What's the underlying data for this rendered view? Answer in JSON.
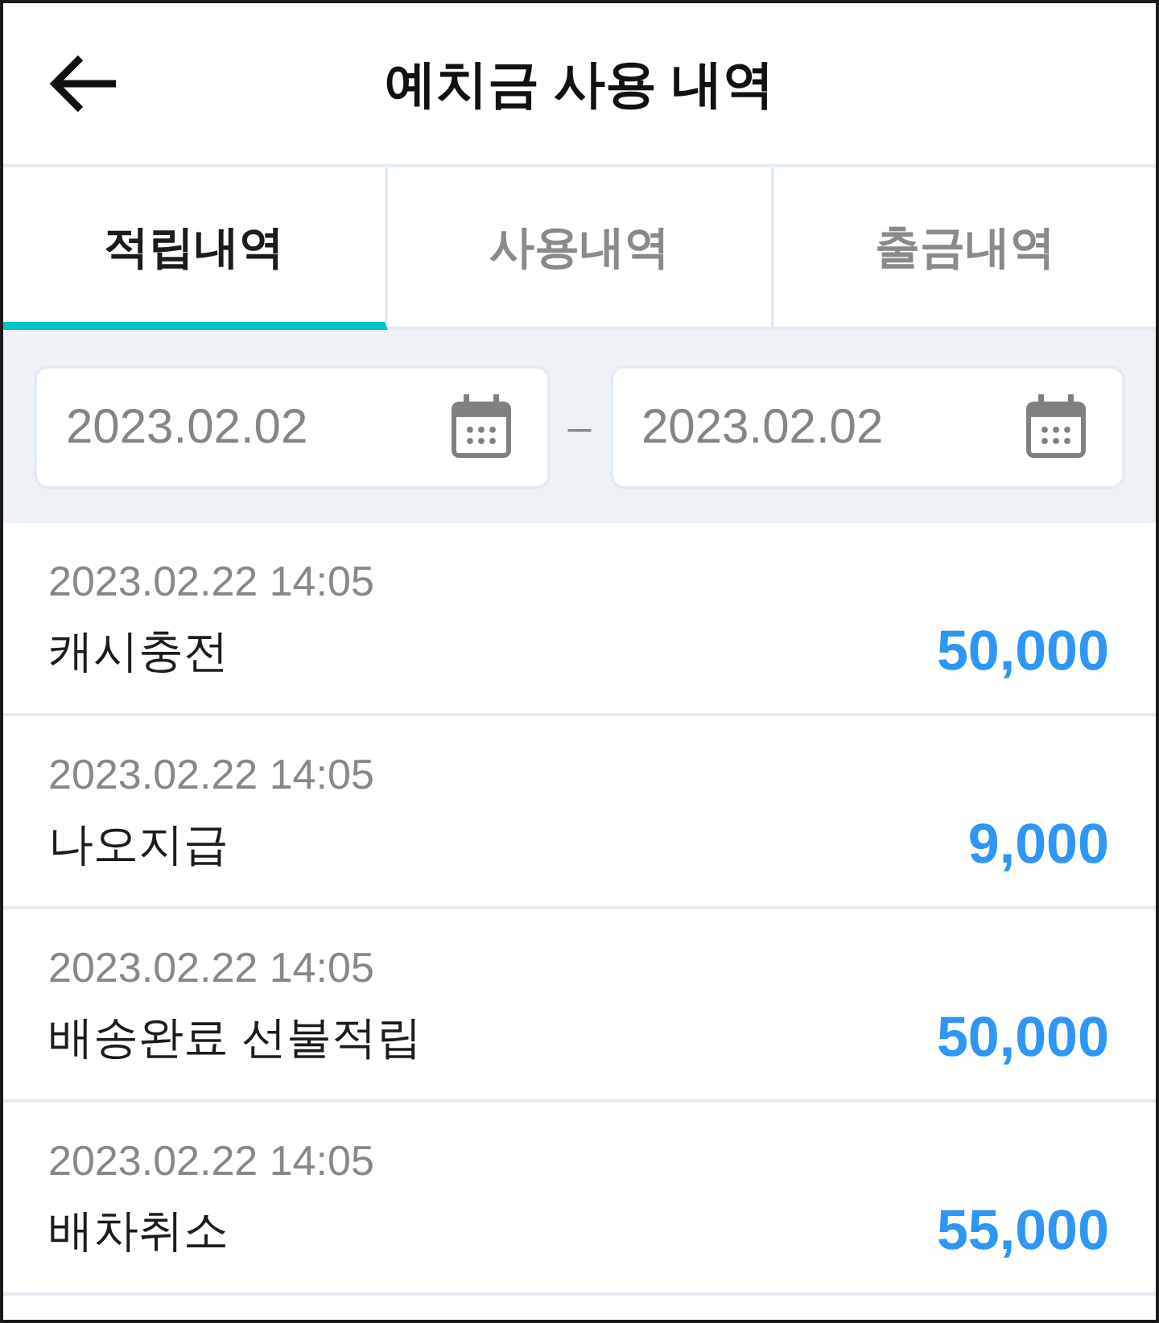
{
  "header": {
    "title": "예치금 사용 내역"
  },
  "tabs": [
    {
      "label": "적립내역",
      "selected": true
    },
    {
      "label": "사용내역",
      "selected": false
    },
    {
      "label": "출금내역",
      "selected": false
    }
  ],
  "date_range": {
    "start": {
      "value": "2023.02.02"
    },
    "separator": "–",
    "end": {
      "value": "2023.02.02"
    }
  },
  "transactions": [
    {
      "datetime": "2023.02.22 14:05",
      "description": "캐시충전",
      "amount": "50,000"
    },
    {
      "datetime": "2023.02.22 14:05",
      "description": "나오지급",
      "amount": "9,000"
    },
    {
      "datetime": "2023.02.22 14:05",
      "description": "배송완료 선불적립",
      "amount": "50,000"
    },
    {
      "datetime": "2023.02.22 14:05",
      "description": "배차취소",
      "amount": "55,000"
    }
  ]
}
